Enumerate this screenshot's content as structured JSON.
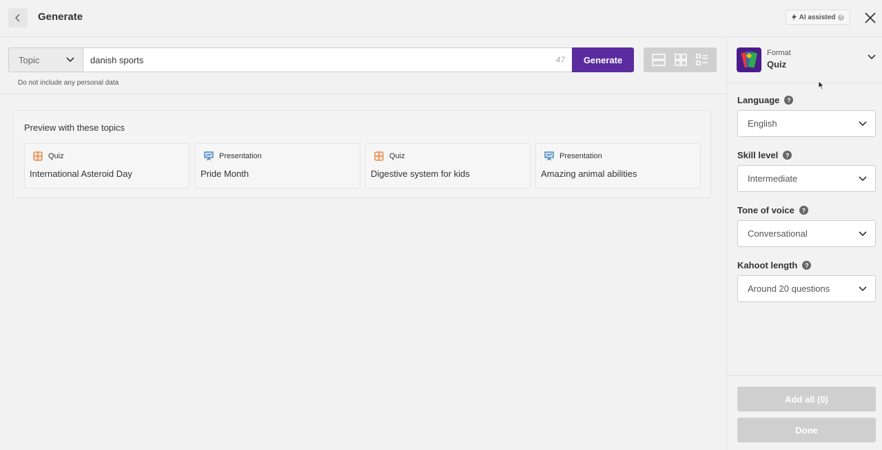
{
  "header": {
    "title": "Generate",
    "ai_badge": "AI assisted"
  },
  "input": {
    "topic_select": "Topic",
    "value": "danish sports",
    "char_count": "47",
    "generate_label": "Generate",
    "hint": "Do not include any personal data"
  },
  "preview": {
    "title": "Preview with these topics",
    "items": [
      {
        "type": "Quiz",
        "name": "International Asteroid Day"
      },
      {
        "type": "Presentation",
        "name": "Pride Month"
      },
      {
        "type": "Quiz",
        "name": "Digestive system for kids"
      },
      {
        "type": "Presentation",
        "name": "Amazing animal abilities"
      }
    ]
  },
  "sidebar": {
    "format_label": "Format",
    "format_value": "Quiz",
    "fields": [
      {
        "label": "Language",
        "value": "English"
      },
      {
        "label": "Skill level",
        "value": "Intermediate"
      },
      {
        "label": "Tone of voice",
        "value": "Conversational"
      },
      {
        "label": "Kahoot length",
        "value": "Around 20 questions"
      }
    ],
    "add_all_label": "Add all (0)",
    "done_label": "Done"
  },
  "colors": {
    "brand": "#5a2ca0",
    "quiz_icon": "#e07a3a",
    "presentation_icon": "#2b6cb0",
    "disabled": "#cfcfcf"
  }
}
